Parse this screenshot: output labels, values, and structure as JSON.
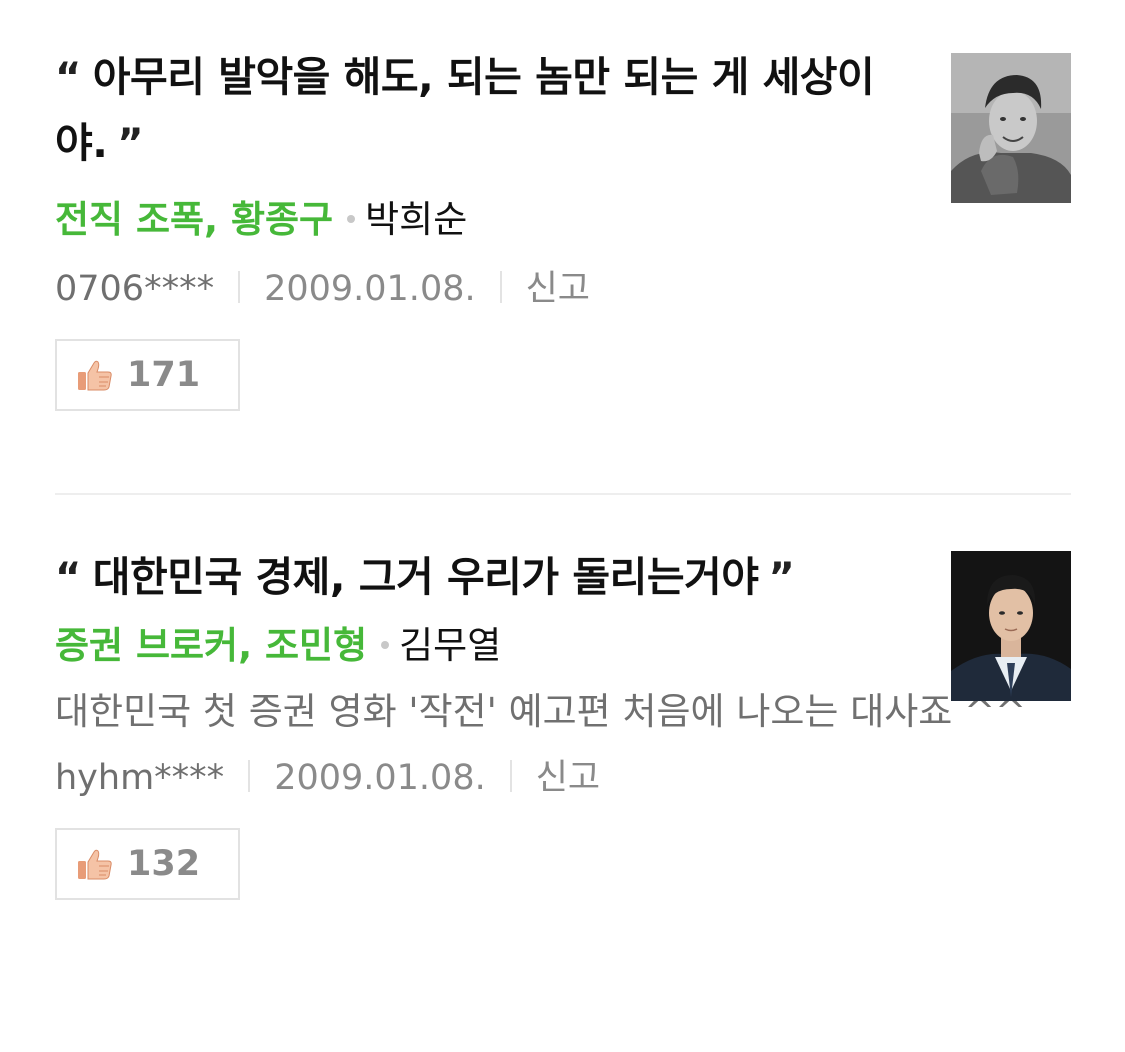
{
  "lines": [
    {
      "quote_open": "“",
      "quote": "아무리 발악을 해도, 되는 놈만 되는 게 세상이야.",
      "quote_close": "”",
      "role": "전직 조폭, 황종구",
      "actor": "박희순",
      "comment": "",
      "user": "0706****",
      "date": "2009.01.08.",
      "report": "신고",
      "likes": "171",
      "photo_icon": "actor-portrait"
    },
    {
      "quote_open": "“",
      "quote": "대한민국 경제, 그거 우리가 돌리는거야",
      "quote_close": "”",
      "role": "증권 브로커, 조민형",
      "actor": "김무열",
      "comment": "대한민국 첫 증권 영화 '작전' 예고편 처음에 나오는 대사죠 ^^",
      "user": "hyhm****",
      "date": "2009.01.08.",
      "report": "신고",
      "likes": "132",
      "photo_icon": "actor-portrait"
    }
  ],
  "colors": {
    "role": "#46b839",
    "meta": "#8a8a8a",
    "comment": "#707070",
    "thumb": "#f2b99a"
  },
  "icons": {
    "like": "thumbs-up-icon"
  }
}
